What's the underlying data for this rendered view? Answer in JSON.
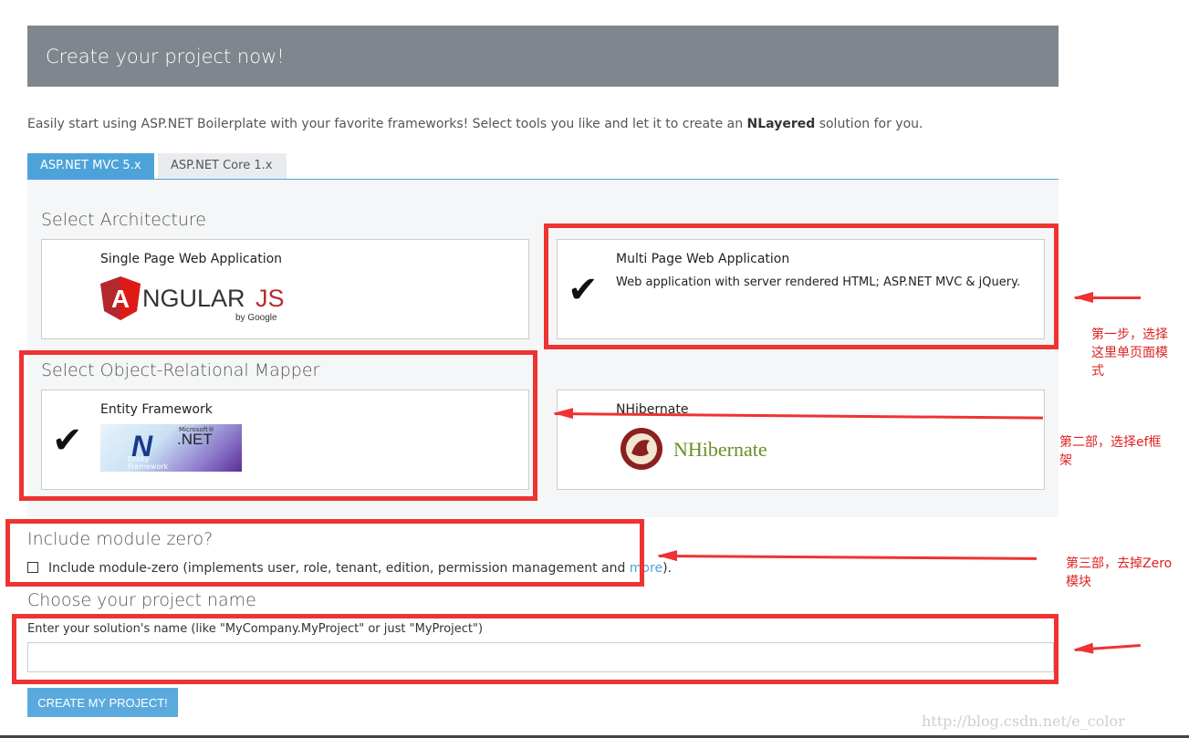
{
  "header": {
    "title": "Create your project now!"
  },
  "intro": {
    "text_before": "Easily start using ASP.NET Boilerplate with your favorite frameworks! Select tools you like and let it to create an ",
    "bold": "NLayered",
    "text_after": " solution for you."
  },
  "tabs": [
    {
      "label": "ASP.NET MVC 5.x",
      "active": true
    },
    {
      "label": "ASP.NET Core 1.x",
      "active": false
    }
  ],
  "architecture": {
    "heading": "Select Architecture",
    "options": [
      {
        "title": "Single Page Web Application",
        "logo_text": "NGULAR",
        "logo_suffix": "JS",
        "logo_by": "by Google",
        "selected": false
      },
      {
        "title": "Multi Page Web Application",
        "description": "Web application with server rendered HTML; ASP.NET MVC & jQuery.",
        "selected": true
      }
    ]
  },
  "orm": {
    "heading": "Select Object-Relational Mapper",
    "options": [
      {
        "title": "Entity Framework",
        "logo_brand": "Microsoft®",
        "logo_text": ".NET",
        "logo_sub1": "Entity",
        "logo_sub2": "Framework",
        "selected": true
      },
      {
        "title": "NHibernate",
        "logo_text": "NHibernate",
        "selected": false
      }
    ]
  },
  "module_zero": {
    "heading": "Include module zero?",
    "label_before": "Include module-zero (implements user, role, tenant, edition, permission management and ",
    "link": "more",
    "label_after": ").",
    "checked": false
  },
  "project_name": {
    "heading": "Choose your project name",
    "hint": "Enter your solution's name (like \"MyCompany.MyProject\" or just \"MyProject\")",
    "value": ""
  },
  "create_button": "CREATE MY PROJECT!",
  "annotations": {
    "step1": "第一步，选择这里单页面模式",
    "step1_lines": [
      "第一步，选择",
      "这里单页面模",
      "式"
    ],
    "step2_lines": [
      "第二部，选择ef框",
      "架"
    ],
    "step3_lines": [
      "第三部，去掉Zero",
      "模块"
    ]
  },
  "watermark": "http://blog.csdn.net/e_color",
  "colors": {
    "accent": "#4da3d9",
    "header": "#7f868e",
    "annotation": "#ee3333"
  }
}
